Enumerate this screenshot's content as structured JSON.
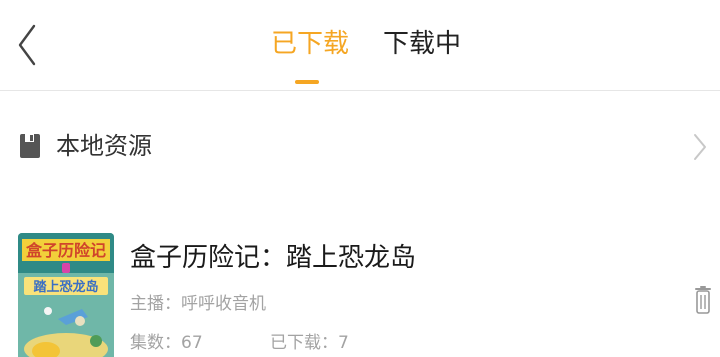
{
  "header": {
    "tabs": [
      {
        "label": "已下载",
        "active": true
      },
      {
        "label": "下载中",
        "active": false
      }
    ],
    "accent_color": "#f5a623"
  },
  "local": {
    "label": "本地资源",
    "icon": "save-icon"
  },
  "downloads": [
    {
      "title": "盒子历险记：踏上恐龙岛",
      "host": "主播：呼呼收音机",
      "episodes": "集数：67",
      "downloaded": "已下载：7",
      "cover_text_top": "盒子历险记",
      "cover_text_mid": "踏上恐龙岛"
    }
  ]
}
